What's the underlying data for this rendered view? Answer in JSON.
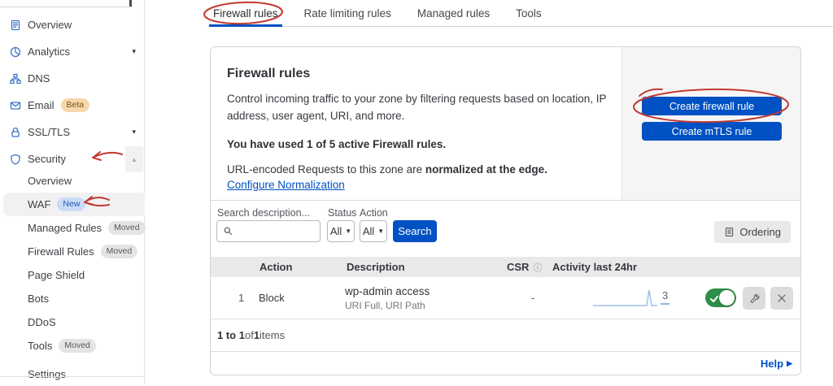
{
  "sidebar": {
    "items": [
      {
        "label": "Overview",
        "icon": "clipboard-icon"
      },
      {
        "label": "Analytics",
        "icon": "pie-chart-icon",
        "caret": "▾"
      },
      {
        "label": "DNS",
        "icon": "network-icon"
      },
      {
        "label": "Email",
        "icon": "envelope-icon",
        "badge": "Beta"
      },
      {
        "label": "SSL/TLS",
        "icon": "lock-icon",
        "caret": "▾"
      },
      {
        "label": "Security",
        "icon": "shield-icon",
        "caret": "▴"
      },
      {
        "label": "Overview"
      },
      {
        "label": "WAF",
        "badge": "New",
        "active": true
      },
      {
        "label": "Managed Rules",
        "badge": "Moved"
      },
      {
        "label": "Firewall Rules",
        "badge": "Moved"
      },
      {
        "label": "Page Shield"
      },
      {
        "label": "Bots"
      },
      {
        "label": "DDoS"
      },
      {
        "label": "Tools",
        "badge": "Moved"
      },
      {
        "label": "Settings"
      }
    ]
  },
  "tabs": {
    "items": [
      {
        "label": "Firewall rules",
        "active": true
      },
      {
        "label": "Rate limiting rules"
      },
      {
        "label": "Managed rules"
      },
      {
        "label": "Tools"
      }
    ]
  },
  "overview_panel": {
    "title": "Firewall rules",
    "description": "Control incoming traffic to your zone by filtering requests based on location, IP address, user agent, URI, and more.",
    "usage": "You have used 1 of 5 active Firewall rules.",
    "normalization_prefix": "URL-encoded Requests to this zone are ",
    "normalization_bold": "normalized at the edge.",
    "normalization_link": "Configure Normalization",
    "create_firewall_button": "Create firewall rule",
    "create_mtls_button": "Create mTLS rule"
  },
  "filters": {
    "search_label": "Search description...",
    "status_label": "Status",
    "status_value": "All",
    "action_label": "Action",
    "action_value": "All",
    "search_button": "Search",
    "ordering_button": "Ordering"
  },
  "table": {
    "columns": {
      "action": "Action",
      "description": "Description",
      "csr": "CSR",
      "csr_info": "ⓘ",
      "activity": "Activity last 24hr"
    },
    "row": {
      "priority": "1",
      "action": "Block",
      "description": "wp-admin access",
      "fields": "URI Full, URI Path",
      "csr": "-",
      "activity_count": "3",
      "activity_sparkline": [
        0,
        0,
        0,
        0,
        0,
        0,
        0,
        0,
        0,
        3,
        0
      ],
      "enabled": true
    }
  },
  "footer": {
    "range": "1 to 1",
    "of_text": " of ",
    "total": "1",
    "items_text": " items",
    "help": "Help"
  },
  "colors": {
    "accent": "#0051c3",
    "toggle_on": "#2e8d47",
    "annotation_red": "#c13a31",
    "badge_new_bg": "#cbdcf7",
    "badge_beta_bg": "#f7d7ab",
    "badge_moved_bg": "#e4e4e4"
  }
}
